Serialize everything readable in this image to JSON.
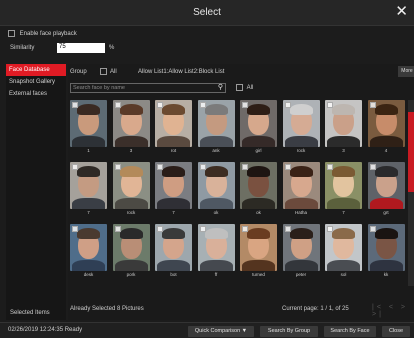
{
  "window": {
    "title": "Select",
    "close_glyph": "✕"
  },
  "enable_face_playback": {
    "label": "Enable face playback",
    "checked": false
  },
  "similarity": {
    "label": "Similarity",
    "value": "75",
    "unit": "%"
  },
  "sidebar": {
    "items": [
      {
        "label": "Face Database",
        "active": true
      },
      {
        "label": "Snapshot Gallery",
        "active": false
      },
      {
        "label": "External faces",
        "active": false
      }
    ],
    "selected_items_label": "Selected Items"
  },
  "toolbar": {
    "group_label": "Group",
    "all_label": "All",
    "list_legend": "Allow List1:Allow List2:Block List",
    "more_label": "More"
  },
  "search": {
    "placeholder": "Search face by name",
    "icon": "search-icon",
    "all_label": "All"
  },
  "faces": [
    {
      "name": "1",
      "bg": "#5d6b74",
      "skin": "#c99a7c",
      "hair": "#3a2a22",
      "shirt": "#2d3136"
    },
    {
      "name": "3",
      "bg": "#8c8a86",
      "skin": "#d9a98c",
      "hair": "#5a3a28",
      "shirt": "#3b2f2a"
    },
    {
      "name": "rot",
      "bg": "#b7aea4",
      "skin": "#e0b392",
      "hair": "#6b4a30",
      "shirt": "#5a4a3f"
    },
    {
      "name": "ank",
      "bg": "#9aa3a8",
      "skin": "#c49a80",
      "hair": "#7b7b7b",
      "shirt": "#4a4f57"
    },
    {
      "name": "girl",
      "bg": "#6f6a68",
      "skin": "#d6a88c",
      "hair": "#2e1e16",
      "shirt": "#352a28"
    },
    {
      "name": "rock",
      "bg": "#aeb2b6",
      "skin": "#d5ab94",
      "hair": "#cfcfcf",
      "shirt": "#3a3d44"
    },
    {
      "name": "3",
      "bg": "#c5c4c3",
      "skin": "#caa089",
      "hair": "#bdb6b0",
      "shirt": "#2b2b2b"
    },
    {
      "name": "4",
      "bg": "#7a5b3f",
      "skin": "#c78c6a",
      "hair": "#3b2412",
      "shirt": "#2f2016"
    },
    {
      "name": "7",
      "bg": "#a5a19b",
      "skin": "#c49b82",
      "hair": "#2f2a26",
      "shirt": "#3a3e45"
    },
    {
      "name": "rock",
      "bg": "#8b8f84",
      "skin": "#e1b596",
      "hair": "#b38a5a",
      "shirt": "#4c4a44"
    },
    {
      "name": "7",
      "bg": "#7b7d82",
      "skin": "#cf9d82",
      "hair": "#2a1d18",
      "shirt": "#2f2f35"
    },
    {
      "name": "ok",
      "bg": "#8f9aa3",
      "skin": "#d9b29a",
      "hair": "#3d2d22",
      "shirt": "#4f5863"
    },
    {
      "name": "ok",
      "bg": "#6d6f63",
      "skin": "#7a5140",
      "hair": "#1e1512",
      "shirt": "#2c2a24"
    },
    {
      "name": "Hatha",
      "bg": "#9b8a7d",
      "skin": "#d7a88e",
      "hair": "#3a2216",
      "shirt": "#6b4a3c"
    },
    {
      "name": "7",
      "bg": "#8a9066",
      "skin": "#e2c49f",
      "hair": "#7a5a33",
      "shirt": "#5b603c"
    },
    {
      "name": "grt",
      "bg": "#5e6268",
      "skin": "#caa18b",
      "hair": "#2a2a2c",
      "shirt": "#b0191f"
    },
    {
      "name": "desk",
      "bg": "#4f6d8a",
      "skin": "#cf9f86",
      "hair": "#4a3a30",
      "shirt": "#2f3f55"
    },
    {
      "name": "pork",
      "bg": "#6c7b6a",
      "skin": "#b98e76",
      "hair": "#2a2a2a",
      "shirt": "#3a3a3a"
    },
    {
      "name": "bot",
      "bg": "#9da7ad",
      "skin": "#d4a58c",
      "hair": "#3a3a3a",
      "shirt": "#3f4650"
    },
    {
      "name": "ff",
      "bg": "#a7b0b4",
      "skin": "#d9b09a",
      "hair": "#bfbfbf",
      "shirt": "#45494f"
    },
    {
      "name": "turned",
      "bg": "#b38a66",
      "skin": "#d9a582",
      "hair": "#6a3c20",
      "shirt": "#54341f"
    },
    {
      "name": "peter",
      "bg": "#70757b",
      "skin": "#cfa085",
      "hair": "#2a1f1a",
      "shirt": "#33363b"
    },
    {
      "name": "sol",
      "bg": "#c2c6c9",
      "skin": "#e0b89e",
      "hair": "#8a6a4a",
      "shirt": "#4a4d52"
    },
    {
      "name": "kk",
      "bg": "#5c6a7a",
      "skin": "#7a5545",
      "hair": "#1a1412",
      "shirt": "#2e3340"
    }
  ],
  "footer": {
    "selected_text": "Already Selected 8 Pictures",
    "page_text": "Current page: 1 / 1, of 25",
    "pager_glyphs": "|< < > >|"
  },
  "status": {
    "datetime": "02/26/2019 12:24:35 Ready",
    "buttons": {
      "quick_comparison": "Quick Comparison ▼",
      "search_by_group": "Search By Group",
      "search_by_face": "Search By Face",
      "close": "Close"
    }
  },
  "colors": {
    "accent": "#e01b24",
    "background": "#1c1c1c"
  }
}
